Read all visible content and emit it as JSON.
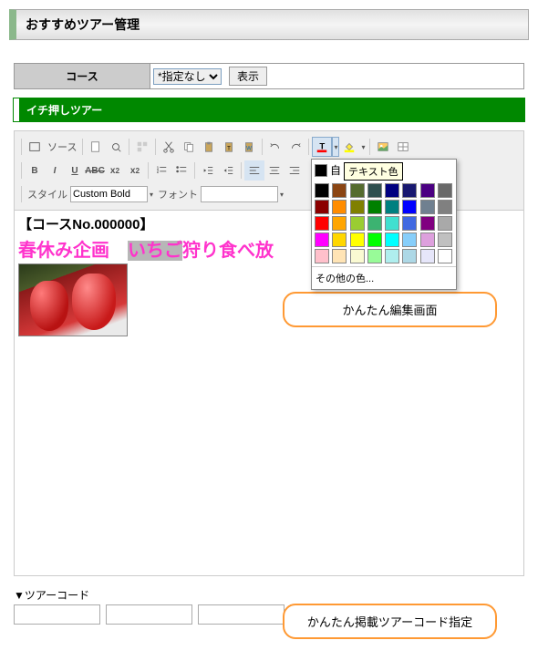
{
  "header": {
    "title": "おすすめツアー管理"
  },
  "course": {
    "label": "コース",
    "select_value": "*指定なし",
    "show_button": "表示"
  },
  "section": {
    "title": "イチ押しツアー"
  },
  "toolbar": {
    "source": "ソース",
    "style_label": "スタイル",
    "style_value": "Custom Bold",
    "font_label": "フォント",
    "font_value": ""
  },
  "color_popup": {
    "auto": "自",
    "tooltip": "テキスト色",
    "more": "その他の色...",
    "colors": [
      "#000000",
      "#8b4513",
      "#556b2f",
      "#2f4f4f",
      "#000080",
      "#191970",
      "#4b0082",
      "#696969",
      "#8b0000",
      "#ff8c00",
      "#808000",
      "#008000",
      "#008080",
      "#0000ff",
      "#708090",
      "#808080",
      "#ff0000",
      "#ffa500",
      "#9acd32",
      "#3cb371",
      "#40e0d0",
      "#4169e1",
      "#800080",
      "#a9a9a9",
      "#ff00ff",
      "#ffd700",
      "#ffff00",
      "#00ff00",
      "#00ffff",
      "#87cefa",
      "#dda0dd",
      "#c0c0c0",
      "#ffc0cb",
      "#ffe4b5",
      "#fafad2",
      "#98fb98",
      "#afeeee",
      "#add8e6",
      "#e6e6fa",
      "#ffffff"
    ]
  },
  "content": {
    "course_no": "【コースNo.000000】",
    "title_before": "春休み企画　",
    "title_sel": "いちご",
    "title_after": "狩り食べ放"
  },
  "callouts": {
    "c1": "かんたん編集画面",
    "c2": "かんたん掲載ツアーコード指定"
  },
  "tourcode": {
    "label": "▼ツアーコード",
    "fields": [
      "",
      "",
      "",
      "",
      ""
    ]
  }
}
